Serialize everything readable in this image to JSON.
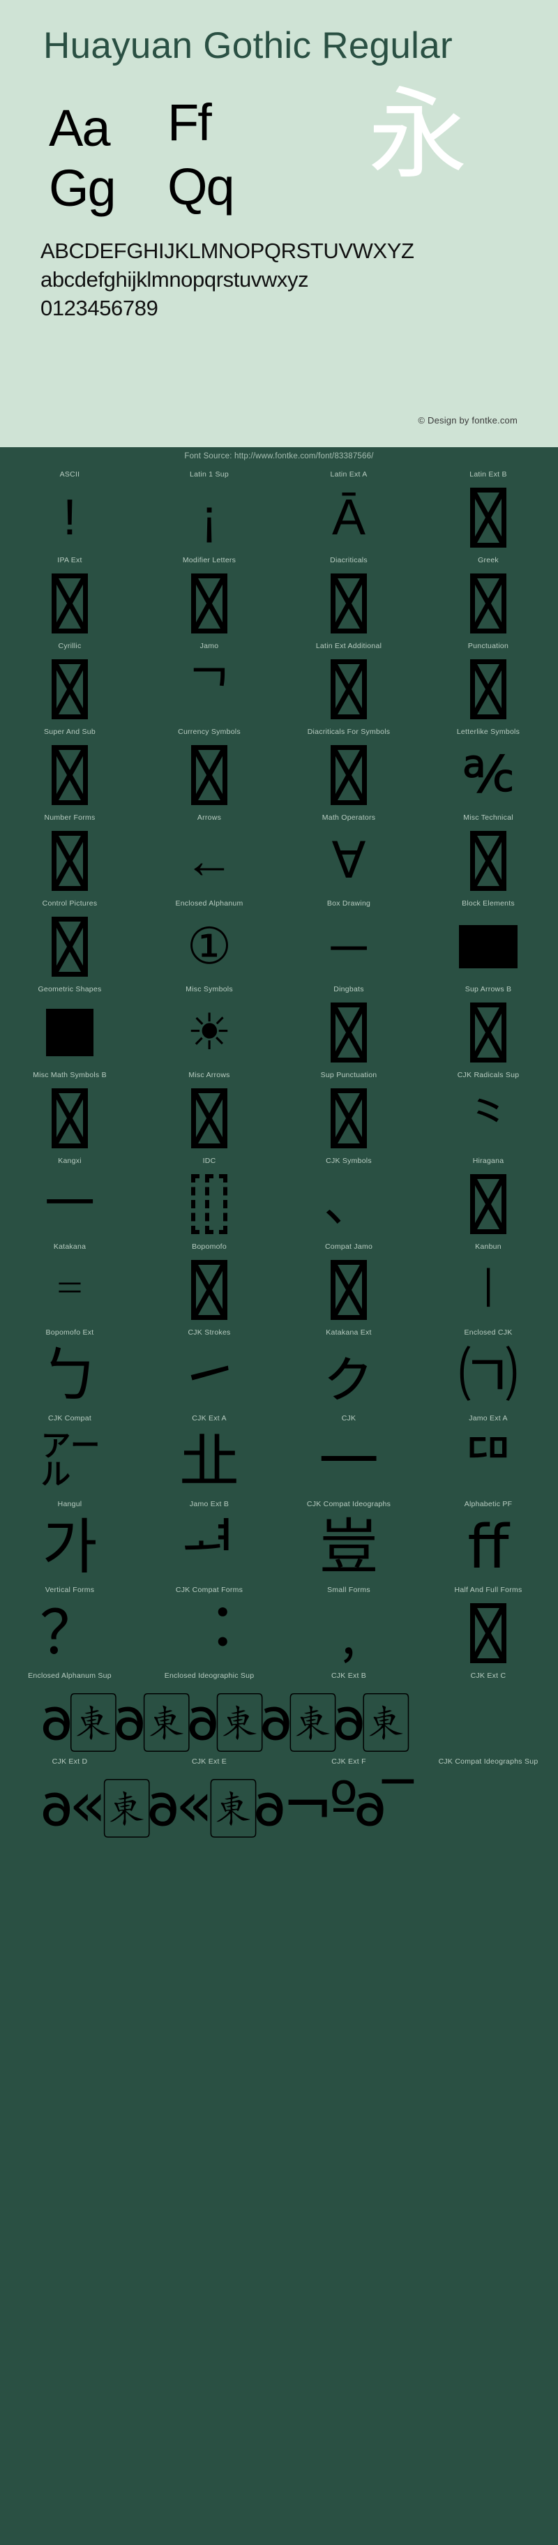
{
  "header": {
    "font_title": "Huayuan Gothic Regular",
    "specimen_pairs": [
      "Aa",
      "Ff",
      "Gg",
      "Qq"
    ],
    "cjk_sample": "永",
    "uppercase": "ABCDEFGHIJKLMNOPQRSTUVWXYZ",
    "lowercase": "abcdefghijklmnopqrstuvwxyz",
    "digits": "0123456789",
    "copyright": "© Design by fontke.com",
    "background_color": "#cfe3d5",
    "title_color": "#2a5043",
    "glyph_color": "#000000",
    "cjk_color": "#ffffff"
  },
  "source_bar": {
    "text": "Font Source: http://www.fontke.com/font/83387566/",
    "background_color": "#2a5043",
    "text_color": "#a8bfb3"
  },
  "grid": {
    "columns": 4,
    "label_color": "#b9cdc2",
    "rows": [
      [
        {
          "label": "ASCII",
          "glyph": "!",
          "kind": "text",
          "size": "lg"
        },
        {
          "label": "Latin 1 Sup",
          "glyph": "¡",
          "kind": "text",
          "size": "lg"
        },
        {
          "label": "Latin Ext A",
          "glyph": "Ā",
          "kind": "text",
          "size": "lg"
        },
        {
          "label": "Latin Ext B",
          "glyph": "",
          "kind": "tofu"
        }
      ],
      [
        {
          "label": "IPA Ext",
          "glyph": "",
          "kind": "tofu"
        },
        {
          "label": "Modifier Letters",
          "glyph": "",
          "kind": "tofu"
        },
        {
          "label": "Diacriticals",
          "glyph": "",
          "kind": "tofu"
        },
        {
          "label": "Greek",
          "glyph": "",
          "kind": "tofu"
        }
      ],
      [
        {
          "label": "Cyrillic",
          "glyph": "",
          "kind": "tofu"
        },
        {
          "label": "Jamo",
          "glyph": "ᄀ",
          "kind": "text",
          "size": "lg"
        },
        {
          "label": "Latin Ext Additional",
          "glyph": "",
          "kind": "tofu"
        },
        {
          "label": "Punctuation",
          "glyph": "",
          "kind": "tofu"
        }
      ],
      [
        {
          "label": "Super And Sub",
          "glyph": "",
          "kind": "tofu"
        },
        {
          "label": "Currency Symbols",
          "glyph": "",
          "kind": "tofu"
        },
        {
          "label": "Diacriticals For Symbols",
          "glyph": "",
          "kind": "tofu"
        },
        {
          "label": "Letterlike Symbols",
          "glyph": "℀",
          "kind": "text",
          "size": "lg"
        }
      ],
      [
        {
          "label": "Number Forms",
          "glyph": "",
          "kind": "tofu"
        },
        {
          "label": "Arrows",
          "glyph": "←",
          "kind": "text",
          "size": "lg"
        },
        {
          "label": "Math Operators",
          "glyph": "∀",
          "kind": "text",
          "size": "lg"
        },
        {
          "label": "Misc Technical",
          "glyph": "",
          "kind": "tofu"
        }
      ],
      [
        {
          "label": "Control Pictures",
          "glyph": "",
          "kind": "tofu"
        },
        {
          "label": "Enclosed Alphanum",
          "glyph": "①",
          "kind": "text",
          "size": "lg"
        },
        {
          "label": "Box Drawing",
          "glyph": "─",
          "kind": "text",
          "size": "lg"
        },
        {
          "label": "Block Elements",
          "glyph": "",
          "kind": "filled-wide"
        }
      ],
      [
        {
          "label": "Geometric Shapes",
          "glyph": "",
          "kind": "filled"
        },
        {
          "label": "Misc Symbols",
          "glyph": "☀",
          "kind": "text",
          "size": "lg"
        },
        {
          "label": "Dingbats",
          "glyph": "",
          "kind": "tofu"
        },
        {
          "label": "Sup Arrows B",
          "glyph": "",
          "kind": "tofu"
        }
      ],
      [
        {
          "label": "Misc Math Symbols B",
          "glyph": "",
          "kind": "tofu"
        },
        {
          "label": "Misc Arrows",
          "glyph": "",
          "kind": "tofu"
        },
        {
          "label": "Sup Punctuation",
          "glyph": "",
          "kind": "tofu"
        },
        {
          "label": "CJK Radicals Sup",
          "glyph": "⺀",
          "kind": "text",
          "size": "lg"
        }
      ],
      [
        {
          "label": "Kangxi",
          "glyph": "一",
          "kind": "text",
          "size": "lg"
        },
        {
          "label": "IDC",
          "glyph": "",
          "kind": "tofu-dashed"
        },
        {
          "label": "CJK Symbols",
          "glyph": "、",
          "kind": "text",
          "size": "lg"
        },
        {
          "label": "Hiragana",
          "glyph": "",
          "kind": "tofu"
        }
      ],
      [
        {
          "label": "Katakana",
          "glyph": "゠",
          "kind": "text",
          "size": "lg"
        },
        {
          "label": "Bopomofo",
          "glyph": "",
          "kind": "tofu"
        },
        {
          "label": "Compat Jamo",
          "glyph": "",
          "kind": "tofu"
        },
        {
          "label": "Kanbun",
          "glyph": "㆐",
          "kind": "text",
          "size": "lg"
        }
      ],
      [
        {
          "label": "Bopomofo Ext",
          "glyph": "ㄅ",
          "kind": "text",
          "size": "xl"
        },
        {
          "label": "CJK Strokes",
          "glyph": "㇀",
          "kind": "text",
          "size": "xl"
        },
        {
          "label": "Katakana Ext",
          "glyph": "ㇰ",
          "kind": "text",
          "size": "xl"
        },
        {
          "label": "Enclosed CJK",
          "glyph": "㈀",
          "kind": "text",
          "size": "xl"
        }
      ],
      [
        {
          "label": "CJK Compat",
          "glyph": "㌃",
          "kind": "text",
          "size": "xl"
        },
        {
          "label": "CJK Ext A",
          "glyph": "㐀",
          "kind": "text",
          "size": "xl"
        },
        {
          "label": "CJK",
          "glyph": "一",
          "kind": "text",
          "size": "xl"
        },
        {
          "label": "Jamo Ext A",
          "glyph": "ꥠ",
          "kind": "text",
          "size": "xl"
        }
      ],
      [
        {
          "label": "Hangul",
          "glyph": "가",
          "kind": "text",
          "size": "xl"
        },
        {
          "label": "Jamo Ext B",
          "glyph": "ힰ",
          "kind": "text",
          "size": "xl"
        },
        {
          "label": "CJK Compat Ideographs",
          "glyph": "豈",
          "kind": "text",
          "size": "xl"
        },
        {
          "label": "Alphabetic PF",
          "glyph": "ﬀ",
          "kind": "text",
          "size": "xl"
        }
      ],
      [
        {
          "label": "Vertical Forms",
          "glyph": "？",
          "kind": "text",
          "size": "xl"
        },
        {
          "label": "CJK Compat Forms",
          "glyph": "︓",
          "kind": "text",
          "size": "xl"
        },
        {
          "label": "Small Forms",
          "glyph": "﹐",
          "kind": "text",
          "size": "xl"
        },
        {
          "label": "Half And Full Forms",
          "glyph": "",
          "kind": "tofu"
        }
      ]
    ],
    "overflow_rows": [
      {
        "labels": [
          "Enclosed Alphanum Sup",
          "Enclosed Ideographic Sup",
          "CJK Ext B",
          "CJK Ext C"
        ],
        "strip": "𐐨🀀𐐨🀀𐐨🀀𐐨🀀𐐨🀀"
      },
      {
        "labels": [
          "CJK Ext D",
          "CJK Ext E",
          "CJK Ext F",
          "CJK Compat Ideographs Sup"
        ],
        "strip": "𐐨«🀀𐐨«🀀𐐨¬º𐐨‾"
      }
    ]
  }
}
